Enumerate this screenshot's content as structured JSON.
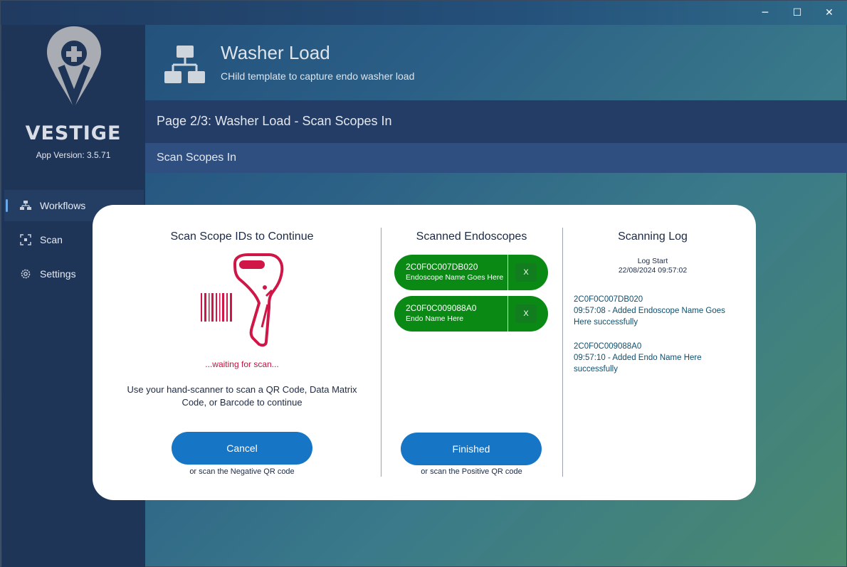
{
  "window": {
    "controls": {
      "minimize": "─",
      "maximize": "☐",
      "close": "✕"
    }
  },
  "sidebar": {
    "brand": "VESTIGE",
    "app_version": "App Version: 3.5.71",
    "items": [
      {
        "label": "Workflows",
        "icon": "workflow-icon",
        "active": true
      },
      {
        "label": "Scan",
        "icon": "scan-icon",
        "active": false
      },
      {
        "label": "Settings",
        "icon": "gear-icon",
        "active": false
      }
    ]
  },
  "header": {
    "title": "Washer Load",
    "subtitle": "CHild template to capture endo washer load",
    "icon": "hierarchy-icon"
  },
  "page": {
    "title": "Page 2/3: Washer Load - Scan Scopes In",
    "section": "Scan Scopes In"
  },
  "modal": {
    "scan": {
      "title": "Scan Scope IDs to Continue",
      "waiting": "...waiting for scan...",
      "instructions": "Use your hand-scanner to scan a QR Code, Data Matrix Code, or Barcode to continue",
      "cancel_label": "Cancel",
      "cancel_hint": "or scan the Negative QR code"
    },
    "scanned": {
      "title": "Scanned Endoscopes",
      "items": [
        {
          "id": "2C0F0C007DB020",
          "name": "Endoscope Name Goes Here",
          "remove_label": "X"
        },
        {
          "id": "2C0F0C009088A0",
          "name": "Endo Name Here",
          "remove_label": "X"
        }
      ],
      "finished_label": "Finished",
      "finished_hint": "or scan the Positive QR code"
    },
    "log": {
      "title": "Scanning Log",
      "start_label": "Log Start",
      "start_time": "22/08/2024 09:57:02",
      "entries": [
        {
          "id": "2C0F0C007DB020",
          "message": "09:57:08 - Added Endoscope Name Goes Here successfully"
        },
        {
          "id": "2C0F0C009088A0",
          "message": "09:57:10 - Added Endo Name Here successfully"
        }
      ]
    }
  },
  "colors": {
    "sidebar_bg": "#1f3558",
    "accent_blue": "#1675c5",
    "scope_green": "#0a8a14",
    "scanner_red": "#c8103c"
  }
}
